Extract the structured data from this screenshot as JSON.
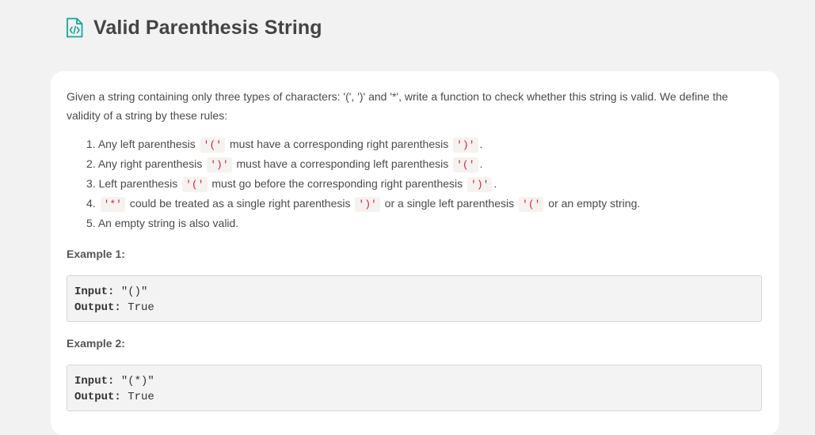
{
  "header": {
    "title": "Valid Parenthesis String",
    "icon": "code-file-icon",
    "accent_color": "#1aa39a"
  },
  "problem": {
    "intro": "Given a string containing only three types of characters: '(', ')' and '*', write a function to check whether this string is valid. We define the validity of a string by these rules:",
    "rules": [
      {
        "num": "1.",
        "parts": [
          {
            "t": "text",
            "v": "Any left parenthesis "
          },
          {
            "t": "code",
            "v": "'('"
          },
          {
            "t": "text",
            "v": " must have a corresponding right parenthesis "
          },
          {
            "t": "code",
            "v": "')'"
          },
          {
            "t": "text",
            "v": "."
          }
        ]
      },
      {
        "num": "2.",
        "parts": [
          {
            "t": "text",
            "v": "Any right parenthesis "
          },
          {
            "t": "code",
            "v": "')'"
          },
          {
            "t": "text",
            "v": " must have a corresponding left parenthesis "
          },
          {
            "t": "code",
            "v": "'('"
          },
          {
            "t": "text",
            "v": "."
          }
        ]
      },
      {
        "num": "3.",
        "parts": [
          {
            "t": "text",
            "v": "Left parenthesis "
          },
          {
            "t": "code",
            "v": "'('"
          },
          {
            "t": "text",
            "v": " must go before the corresponding right parenthesis "
          },
          {
            "t": "code",
            "v": "')'"
          },
          {
            "t": "text",
            "v": "."
          }
        ]
      },
      {
        "num": "4.",
        "parts": [
          {
            "t": "text",
            "v": ""
          },
          {
            "t": "code",
            "v": "'*'"
          },
          {
            "t": "text",
            "v": " could be treated as a single right parenthesis "
          },
          {
            "t": "code",
            "v": "')'"
          },
          {
            "t": "text",
            "v": " or a single left parenthesis "
          },
          {
            "t": "code",
            "v": "'('"
          },
          {
            "t": "text",
            "v": " or an empty string."
          }
        ]
      },
      {
        "num": "5.",
        "parts": [
          {
            "t": "text",
            "v": "An empty string is also valid."
          }
        ]
      }
    ],
    "examples": [
      {
        "label": "Example 1:",
        "input_key": "Input:",
        "input_value": " \"()\"",
        "output_key": "Output:",
        "output_value": " True"
      },
      {
        "label": "Example 2:",
        "input_key": "Input:",
        "input_value": " \"(*)\"",
        "output_key": "Output:",
        "output_value": " True"
      }
    ]
  }
}
